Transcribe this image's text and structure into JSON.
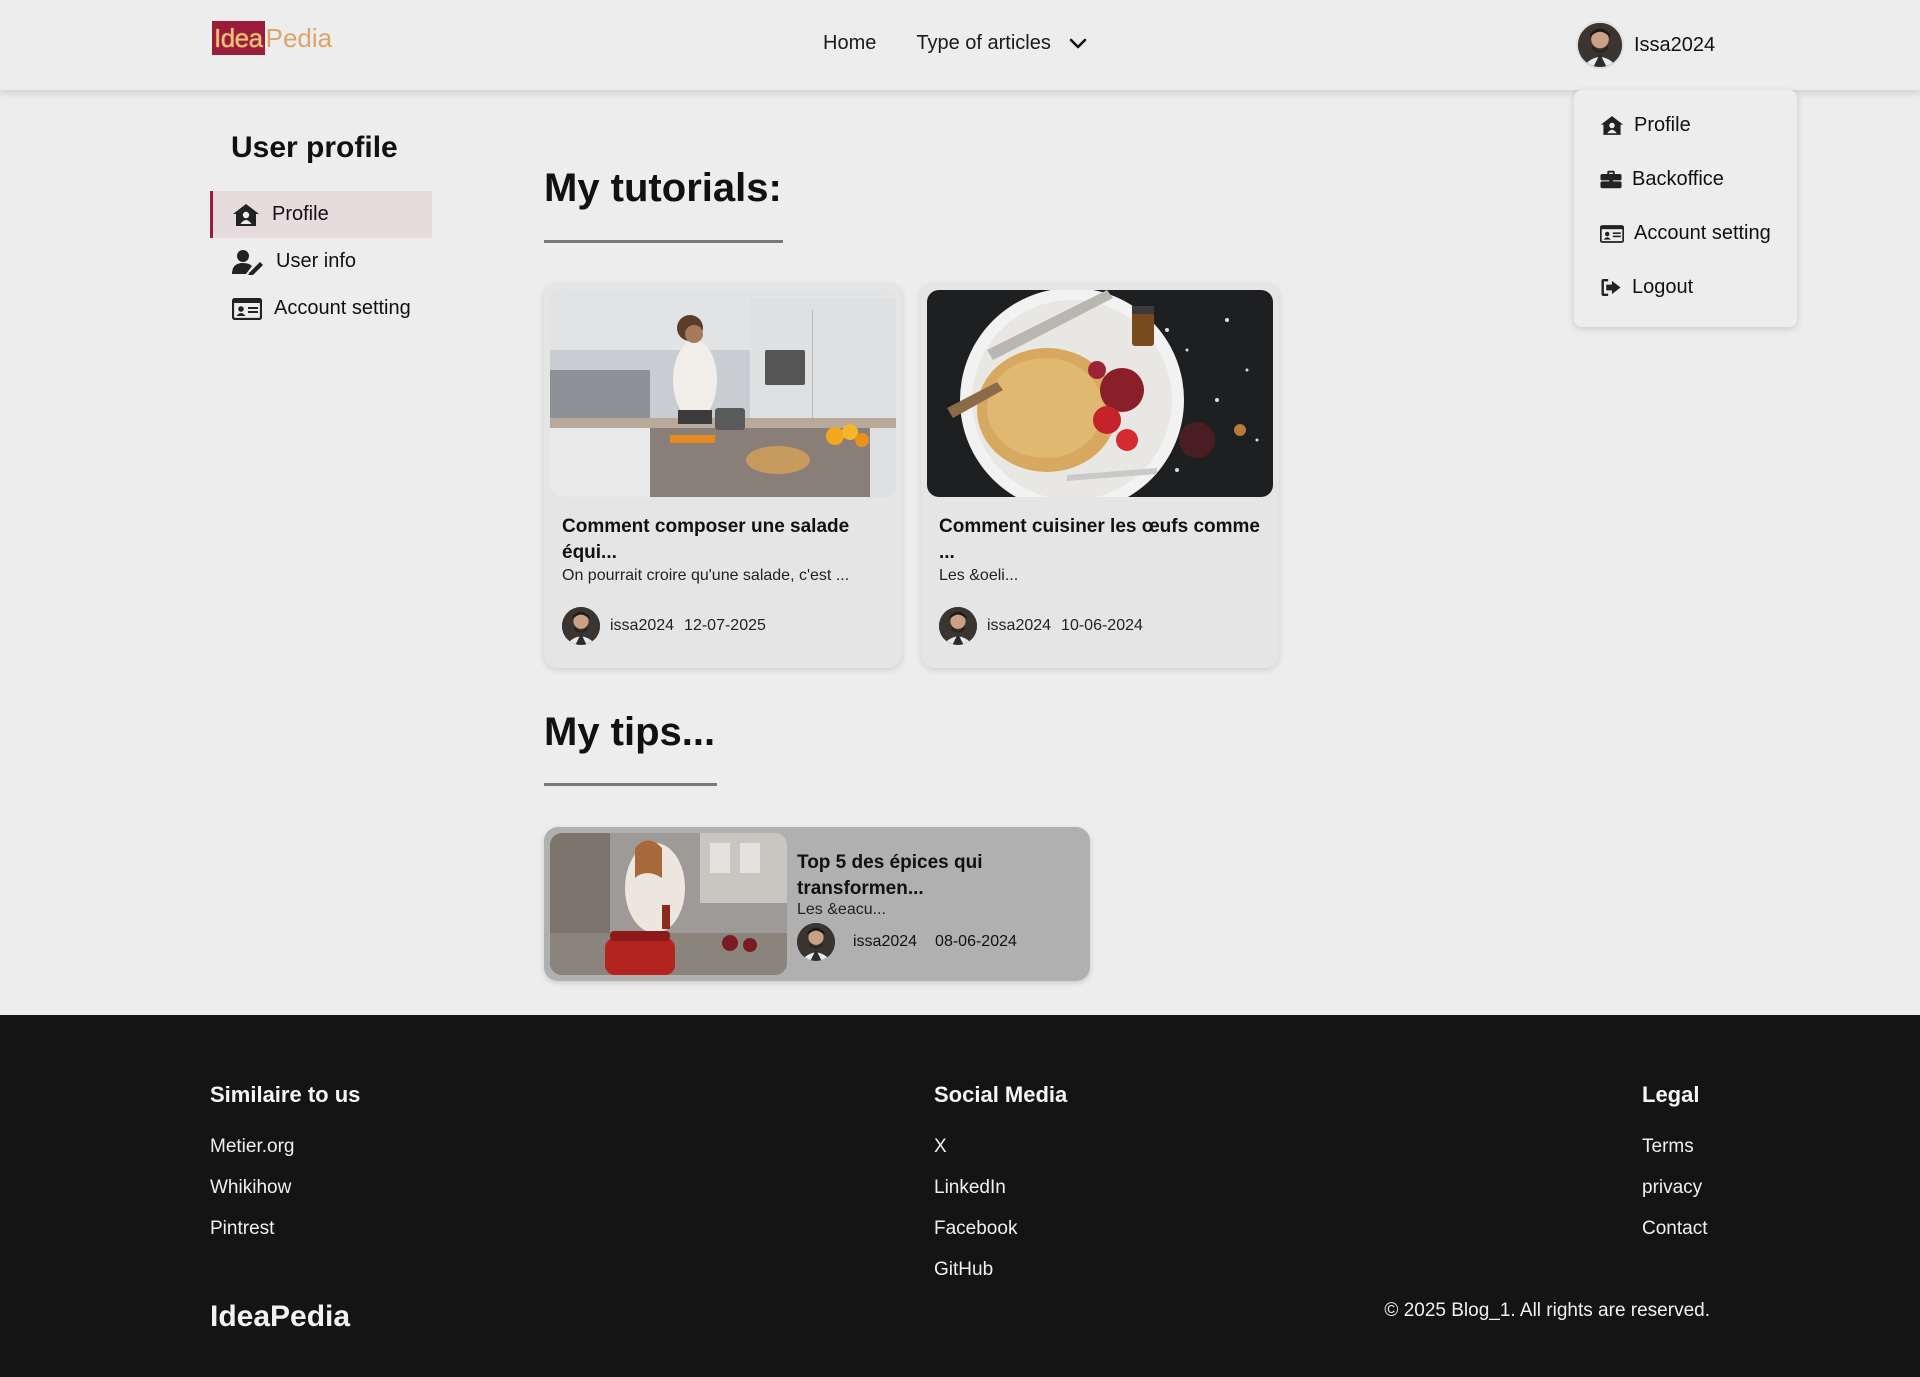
{
  "navbar": {
    "logo_idea": "Idea",
    "logo_pedia": "Pedia",
    "links": {
      "home": "Home",
      "articles": "Type of articles"
    },
    "user_name": "Issa2024"
  },
  "dropdown": {
    "items": [
      {
        "label": "Profile",
        "icon": "home-user-icon"
      },
      {
        "label": "Backoffice",
        "icon": "briefcase-icon"
      },
      {
        "label": "Account setting",
        "icon": "id-card-icon"
      },
      {
        "label": "Logout",
        "icon": "logout-icon"
      }
    ]
  },
  "sidebar": {
    "title": "User profile",
    "items": [
      {
        "label": "Profile",
        "icon": "home-user-icon",
        "active": true
      },
      {
        "label": "User info",
        "icon": "user-edit-icon",
        "active": false
      },
      {
        "label": "Account setting",
        "icon": "id-card-icon",
        "active": false
      }
    ]
  },
  "tutorials": {
    "heading": "My tutorials:",
    "cards": [
      {
        "title": "Comment composer une salade équi...",
        "excerpt": "On pourrait croire qu'une salade, c'est ...",
        "author": "issa2024",
        "date": "12-07-2025"
      },
      {
        "title": "Comment cuisiner les œufs comme ...",
        "excerpt": "Les &oeli...",
        "author": "issa2024",
        "date": "10-06-2024"
      }
    ]
  },
  "tips": {
    "heading": "My tips...",
    "cards": [
      {
        "title": "Top 5 des épices qui transformen...",
        "excerpt": "Les &eacu...",
        "author": "issa2024",
        "date": "08-06-2024"
      }
    ]
  },
  "footer": {
    "similar": {
      "heading": "Similaire to us",
      "links": [
        "Metier.org",
        "Whikihow",
        "Pintrest"
      ]
    },
    "social": {
      "heading": "Social Media",
      "links": [
        "X",
        "LinkedIn",
        "Facebook",
        "GitHub"
      ]
    },
    "legal": {
      "heading": "Legal",
      "links": [
        "Terms",
        "privacy",
        "Contact"
      ]
    },
    "brand": "IdeaPedia",
    "copyright": "© 2025 Blog_1. All rights are reserved."
  },
  "colors": {
    "accent": "#9b1c3a",
    "background": "#eeeded",
    "footer_bg": "#141414"
  }
}
